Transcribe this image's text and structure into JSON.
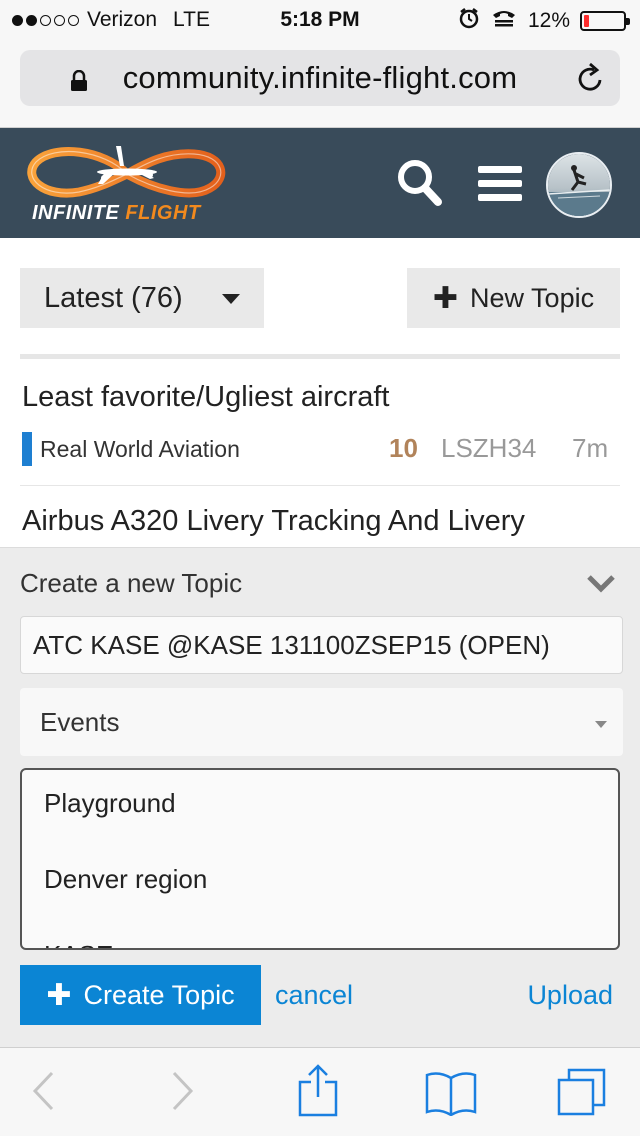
{
  "status_bar": {
    "carrier": "Verizon",
    "network": "LTE",
    "time": "5:18 PM",
    "battery_percent": "12%",
    "battery_level": 0.12,
    "signal_bars_filled": 2,
    "signal_bars_total": 5,
    "icons": [
      "alarm-clock-icon",
      "tty-icon",
      "battery-icon"
    ]
  },
  "browser": {
    "url": "community.infinite-flight.com",
    "icons": [
      "lock-icon",
      "reload-icon"
    ]
  },
  "forum_header": {
    "logo_text_part1": "INFINITE",
    "logo_text_part2": "FLIGHT",
    "icons": [
      "search-icon",
      "hamburger-menu-icon",
      "user-avatar"
    ],
    "colors": {
      "header_bg": "#394b5a",
      "logo_orange": "#f28a1e"
    }
  },
  "topic_list": {
    "filter_label": "Latest (76)",
    "new_topic_label": "New Topic",
    "topics": [
      {
        "title": "Least favorite/Ugliest aircraft",
        "category": "Real World Aviation",
        "category_color": "#1e7fd1",
        "replies": "10",
        "last_poster": "LSZH34",
        "age": "7m"
      },
      {
        "title": "Airbus A320 Livery Tracking And Livery"
      }
    ]
  },
  "composer": {
    "heading": "Create a new Topic",
    "title_value": "ATC KASE @KASE 131100ZSEP15 (OPEN)",
    "category_selected": "Events",
    "body_lines": [
      "Playground",
      "Denver region",
      "KASE"
    ],
    "create_label": "Create Topic",
    "cancel_label": "cancel",
    "upload_label": "Upload",
    "colors": {
      "primary": "#0b85d4"
    }
  },
  "safari_toolbar": {
    "icons": [
      "back-icon",
      "forward-icon",
      "share-icon",
      "bookmarks-icon",
      "tabs-icon"
    ]
  }
}
